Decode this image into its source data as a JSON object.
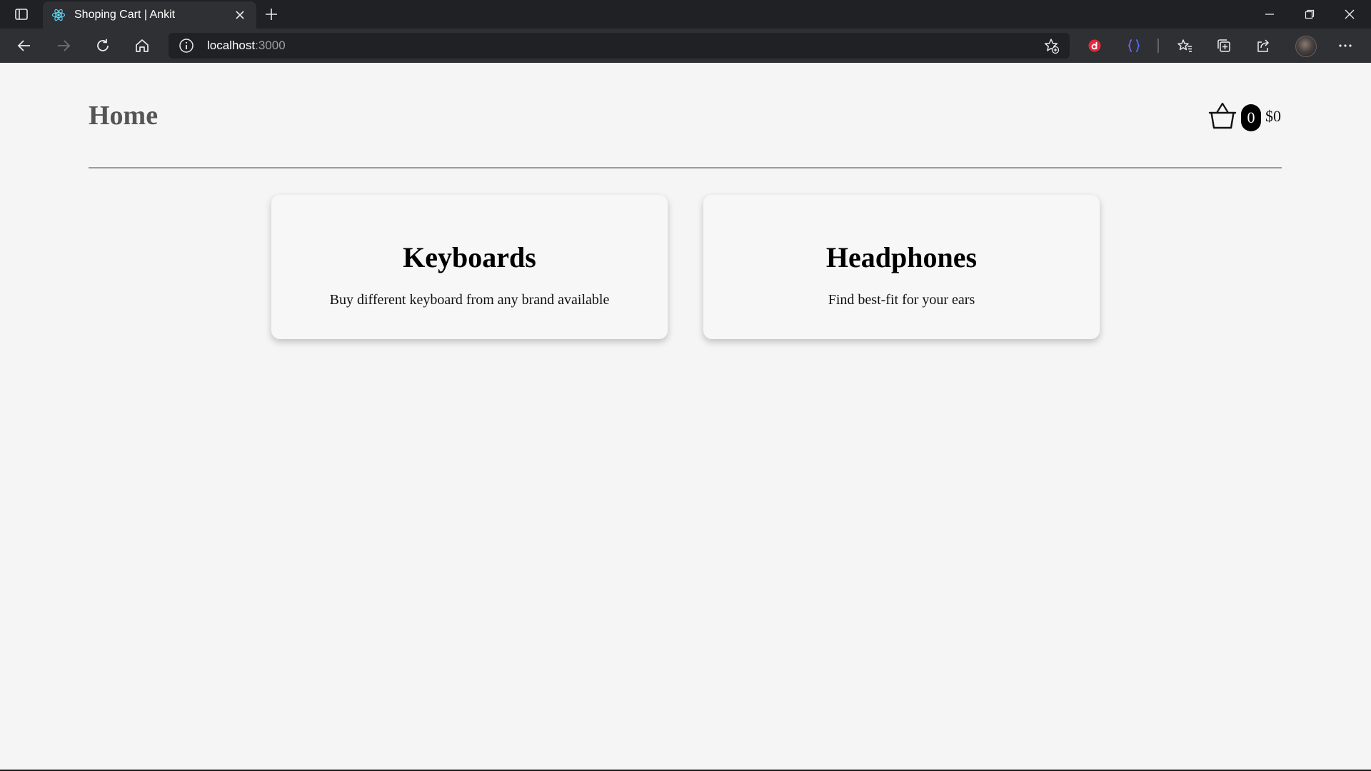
{
  "browser": {
    "tab": {
      "title": "Shoping Cart | Ankit",
      "favicon": "react-icon"
    },
    "address": {
      "host": "localhost",
      "port": ":3000"
    },
    "icons": {
      "tab_actions": "tab-actions-icon",
      "close_tab": "close-icon",
      "new_tab": "plus-icon",
      "back": "arrow-left-icon",
      "forward": "arrow-right-icon",
      "refresh": "refresh-icon",
      "home": "home-icon",
      "site_info": "info-icon",
      "add_favorite": "star-add-icon",
      "extension_1": "extension-red-icon",
      "extension_2": "extension-braces-icon",
      "favorites": "favorites-icon",
      "collections": "collections-icon",
      "share": "share-icon",
      "profile": "avatar",
      "menu": "more-icon",
      "minimize": "minimize-icon",
      "maximize": "restore-icon",
      "close_window": "close-icon"
    }
  },
  "header": {
    "title": "Home",
    "cart": {
      "count": "0",
      "total": "$0",
      "icon": "basket-icon"
    }
  },
  "categories": [
    {
      "title": "Keyboards",
      "description": "Buy different keyboard from any brand available"
    },
    {
      "title": "Headphones",
      "description": "Find best-fit for your ears"
    }
  ],
  "colors": {
    "page_background": "#f5f5f5",
    "title_gray": "#555555",
    "chrome_dark": "#202124",
    "chrome_toolbar": "#2f3033",
    "badge": "#000000"
  }
}
